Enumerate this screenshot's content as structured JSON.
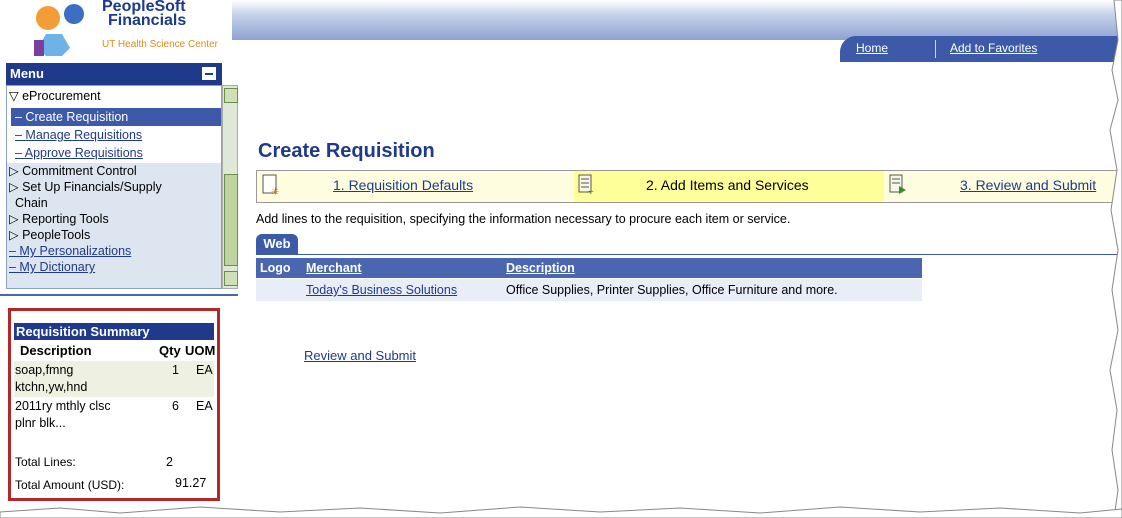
{
  "logo": {
    "title_line1": "PeopleSoft",
    "title_line2": "Financials",
    "subtitle": "UT Health Science Center"
  },
  "header": {
    "home_label": "Home",
    "favorites_label": "Add to Favorites"
  },
  "menu": {
    "title": "Menu",
    "items": [
      {
        "label": "▽ eProcurement"
      },
      {
        "label": "– Create Requisition"
      },
      {
        "label": "– Manage Requisitions"
      },
      {
        "label": "– Approve Requisitions"
      },
      {
        "label": "▷ Commitment Control"
      },
      {
        "label": "▷ Set Up Financials/Supply"
      },
      {
        "label": "Chain"
      },
      {
        "label": "▷ Reporting Tools"
      },
      {
        "label": "▷ PeopleTools"
      },
      {
        "label": "– My Personalizations"
      },
      {
        "label": "– My Dictionary"
      }
    ]
  },
  "summary": {
    "title": "Requisition Summary",
    "col_description": "Description",
    "col_qty": "Qty",
    "col_uom": "UOM",
    "rows": [
      {
        "desc1": "soap,fmng",
        "desc2": "ktchn,yw,hnd",
        "qty": "1",
        "uom": "EA"
      },
      {
        "desc1": "2011ry mthly clsc",
        "desc2": "plnr blk...",
        "qty": "6",
        "uom": "EA"
      }
    ],
    "total_lines_label": "Total Lines:",
    "total_lines_value": "2",
    "total_amount_label": "Total Amount (USD):",
    "total_amount_value": "91.27"
  },
  "main": {
    "page_title": "Create Requisition",
    "steps": [
      {
        "label": "1. Requisition Defaults"
      },
      {
        "label": "2. Add Items and Services"
      },
      {
        "label": "3. Review and Submit"
      }
    ],
    "instructions": "Add lines to the requisition, specifying the information necessary to procure each item or service.",
    "tab_web": "Web",
    "grid": {
      "col_logo": "Logo",
      "col_merchant": "Merchant",
      "col_description": "Description",
      "rows": [
        {
          "merchant": "Today's Business Solutions",
          "description": "Office Supplies, Printer Supplies, Office Furniture and more."
        }
      ]
    },
    "review_link": "Review and Submit"
  },
  "colors": {
    "brand_blue": "#1f3a8a",
    "header_blue": "#3d5aa8",
    "highlight_yellow": "#ffff99",
    "summary_border": "#b32727"
  }
}
